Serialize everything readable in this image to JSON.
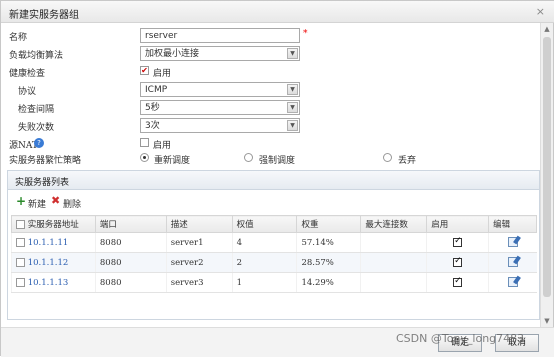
{
  "window": {
    "title": "新建实服务器组",
    "close_glyph": "×"
  },
  "form": {
    "name": {
      "label": "名称",
      "value": "rserver",
      "required_mark": "*"
    },
    "lb_algorithm": {
      "label": "负载均衡算法",
      "value": "加权最小连接"
    },
    "health_check": {
      "label": "健康检查",
      "enable_label": "启用",
      "enabled": true
    },
    "protocol": {
      "label": "协议",
      "value": "ICMP"
    },
    "interval": {
      "label": "检查间隔",
      "value": "5秒"
    },
    "fail_count": {
      "label": "失败次数",
      "value": "3次"
    },
    "source_nat": {
      "label": "源NAT",
      "enable_label": "启用",
      "enabled": false
    },
    "busy_policy": {
      "label": "实服务器繁忙策略",
      "options": [
        {
          "label": "重新调度",
          "selected": true
        },
        {
          "label": "强制调度",
          "selected": false
        },
        {
          "label": "丢弃",
          "selected": false
        }
      ]
    }
  },
  "server_list": {
    "title": "实服务器列表",
    "toolbar": {
      "add_label": "新建",
      "delete_label": "删除"
    },
    "columns": [
      "实服务器地址",
      "端口",
      "描述",
      "权值",
      "权重",
      "最大连接数",
      "启用",
      "编辑"
    ],
    "rows": [
      {
        "address": "10.1.1.11",
        "port": "8080",
        "desc": "server1",
        "weight_value": "4",
        "weight_pct": "57.14%",
        "max_conn": "",
        "enabled": true
      },
      {
        "address": "10.1.1.12",
        "port": "8080",
        "desc": "server2",
        "weight_value": "2",
        "weight_pct": "28.57%",
        "max_conn": "",
        "enabled": true
      },
      {
        "address": "10.1.1.13",
        "port": "8080",
        "desc": "server3",
        "weight_value": "1",
        "weight_pct": "14.29%",
        "max_conn": "",
        "enabled": true
      }
    ]
  },
  "footer": {
    "ok_label": "确定",
    "cancel_label": "取消"
  },
  "watermark": "CSDN @Tony_long7483",
  "colors": {
    "link": "#2a5db0",
    "required": "#e00000",
    "panel_border": "#cdd6e0"
  }
}
